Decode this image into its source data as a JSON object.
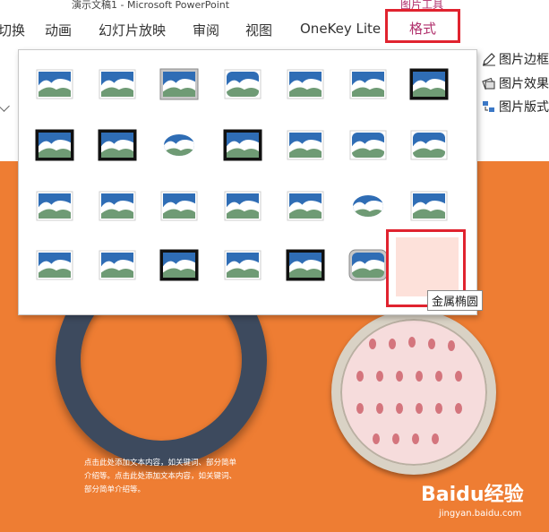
{
  "window": {
    "title": "演示文稿1 - Microsoft PowerPoint",
    "context_tab_group": "图片工具"
  },
  "tabs": [
    {
      "label": "切换"
    },
    {
      "label": "动画"
    },
    {
      "label": "幻灯片放映"
    },
    {
      "label": "审阅"
    },
    {
      "label": "视图"
    },
    {
      "label": "OneKey Lite"
    },
    {
      "label": "格式",
      "active": true
    }
  ],
  "ribbon": {
    "picture_border": "图片边框",
    "picture_effects": "图片效果",
    "picture_layout": "图片版式"
  },
  "picture_styles_gallery": {
    "rows": 4,
    "columns": 7,
    "selected_style_tooltip": "金属椭圆",
    "style_icons": [
      [
        "simple-frame-white",
        "beveled-matte-white",
        "metal-frame",
        "reflected-rounded-rectangle",
        "reflected-soft-edge",
        "soft-edge-rectangle",
        "double-frame-black"
      ],
      [
        "thick-matte-black",
        "simple-black-shadow",
        "oval-shadow",
        "compound-frame-black",
        "center-shadow-rectangle",
        "rounded-diagonal-corner",
        "snip-diagonal-corner"
      ],
      [
        "moderate-frame-white",
        "drop-shadow-rectangle",
        "rotated-white",
        "perspective-shadow",
        "relaxed-perspective",
        "soft-edge-oval",
        "bevel-rectangle"
      ],
      [
        "bevel-perspective",
        "reflected-bevel",
        "moderate-frame-black",
        "bevel-perspective-left",
        "reflected-bevel-black",
        "metal-rounded-rectangle",
        "metal-oval"
      ]
    ]
  },
  "slide": {
    "body_text": "点击此处添加文本内容，如关键词、部分简单介绍等。点击此处添加文本内容，如关键词、部分简单介绍等。",
    "watermark": "Baidu经验",
    "watermark_url": "jingyan.baidu.com"
  },
  "colors": {
    "accent_format_tab": "#b0306c",
    "highlight_box": "#e0232f",
    "slide_bg": "#ee7d33",
    "ring": "#3d4a5e"
  }
}
